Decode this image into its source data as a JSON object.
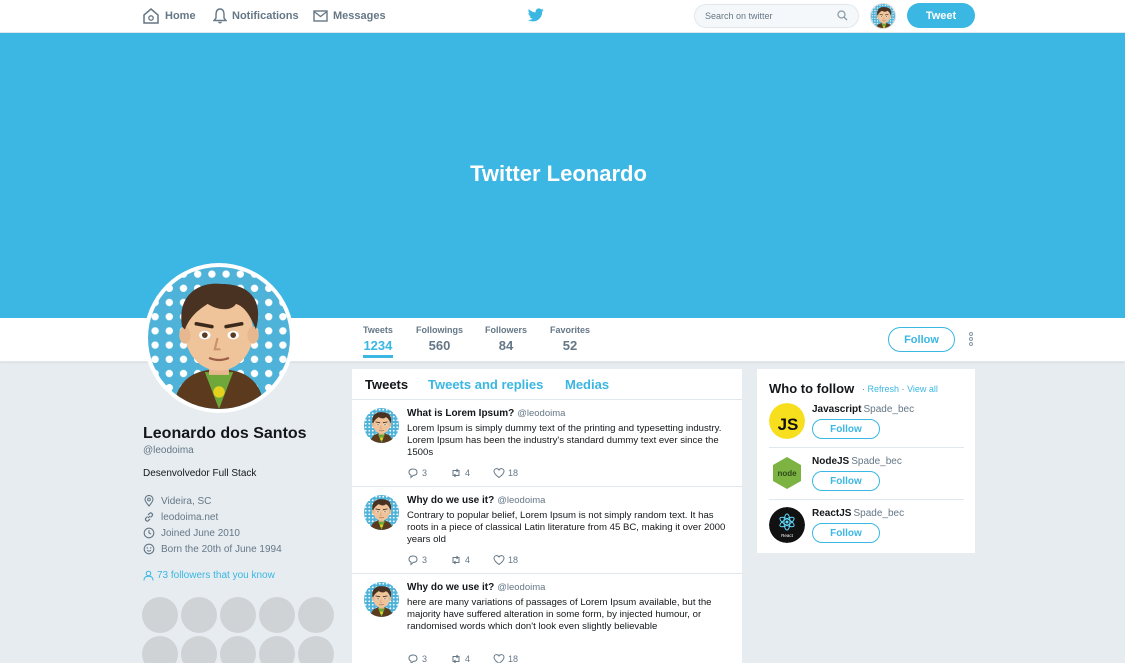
{
  "nav": {
    "home": "Home",
    "notifications": "Notifications",
    "messages": "Messages",
    "search_placeholder": "Search on twitter",
    "tweet_button": "Tweet"
  },
  "banner": {
    "title": "Twitter Leonardo"
  },
  "stats": [
    {
      "label": "Tweets",
      "value": "1234"
    },
    {
      "label": "Followings",
      "value": "560"
    },
    {
      "label": "Followers",
      "value": "84"
    },
    {
      "label": "Favorites",
      "value": "52"
    }
  ],
  "profile_actions": {
    "follow": "Follow"
  },
  "profile": {
    "name": "Leonardo dos Santos",
    "handle": "@leodoima",
    "bio": "Desenvolvedor Full Stack",
    "location": "Videira, SC",
    "website": "leodoima.net",
    "joined": "Joined June 2010",
    "birthday": "Born the 20th of June 1994",
    "followers_you_know": "73 followers that you know"
  },
  "tabs": [
    "Tweets",
    "Tweets and replies",
    "Medias"
  ],
  "tweets": [
    {
      "title": "What is Lorem Ipsum?",
      "handle": "@leodoima",
      "text": "Lorem Ipsum is simply dummy text of the printing and typesetting industry. Lorem Ipsum has been the industry's standard dummy text ever since the 1500s",
      "replies": "3",
      "retweets": "4",
      "likes": "18"
    },
    {
      "title": "Why do we use it?",
      "handle": "@leodoima",
      "text": "Contrary to popular belief, Lorem Ipsum is not simply random text. It has roots in a piece of classical Latin literature from 45 BC, making it over 2000 years old",
      "replies": "3",
      "retweets": "4",
      "likes": "18"
    },
    {
      "title": "Why do we use it?",
      "handle": "@leodoima",
      "text": "here are many variations of passages of Lorem Ipsum available, but the majority have suffered alteration in some form, by injected humour, or randomised words which don't look even slightly believable",
      "replies": "3",
      "retweets": "4",
      "likes": "18"
    }
  ],
  "who_to_follow": {
    "title": "Who to follow",
    "refresh": "Refresh",
    "view_all": "View all",
    "separator": "·",
    "items": [
      {
        "name": "Javascript",
        "handle": "Spade_bec",
        "follow": "Follow",
        "logo_text": "JS"
      },
      {
        "name": "NodeJS",
        "handle": "Spade_bec",
        "follow": "Follow",
        "logo_text": "node"
      },
      {
        "name": "ReactJS",
        "handle": "Spade_bec",
        "follow": "Follow",
        "logo_text": "React"
      }
    ]
  },
  "colors": {
    "accent": "#3ab7e2",
    "banner": "#3cb6e3",
    "background": "#e6ecf0"
  }
}
